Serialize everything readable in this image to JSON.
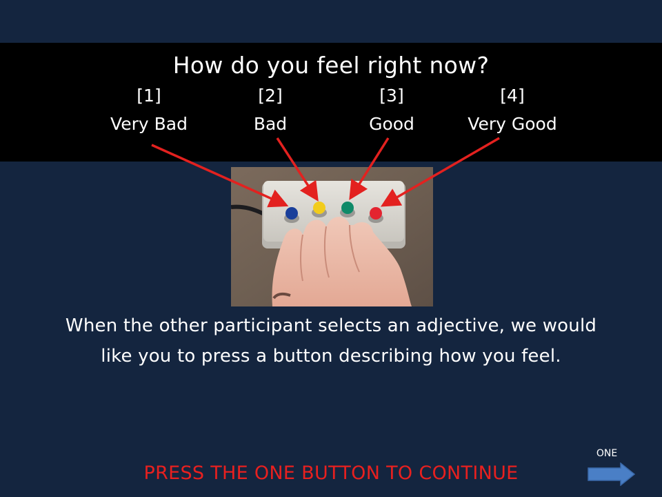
{
  "question": "How do you feel right now?",
  "options": [
    {
      "number": "[1]",
      "label": "Very Bad",
      "button_color": "#1a3f9a"
    },
    {
      "number": "[2]",
      "label": "Bad",
      "button_color": "#f2cc1c"
    },
    {
      "number": "[3]",
      "label": "Good",
      "button_color": "#0f8a68"
    },
    {
      "number": "[4]",
      "label": "Very Good",
      "button_color": "#e32430"
    }
  ],
  "instruction_line1": "When the other participant selects an adjective, we would",
  "instruction_line2": "like you to press a button describing how you feel.",
  "continue_text": "PRESS THE ONE BUTTON TO CONTINUE",
  "next_label": "ONE",
  "colors": {
    "background": "#14253f",
    "header_band": "#000000",
    "arrow": "#e3211f",
    "continue_text": "#e8201f",
    "next_arrow": "#4a7fc6"
  },
  "icons": {
    "next": "right-arrow-icon"
  }
}
